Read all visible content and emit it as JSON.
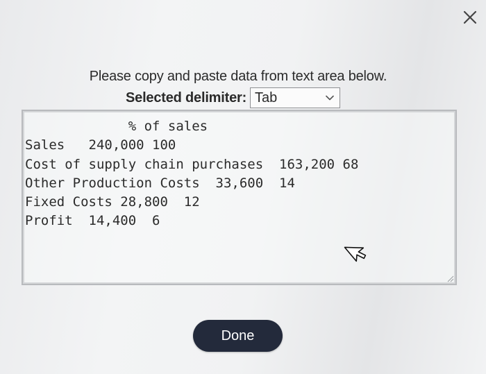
{
  "dialog": {
    "close_icon": "close-icon",
    "instructions": "Please copy and paste data from text area below.",
    "delimiter_label": "Selected delimiter:",
    "delimiter_value": "Tab",
    "text_area": {
      "lines": [
        "             % of sales",
        "Sales\t240,000 100",
        "Cost of supply chain purchases\t163,200 68",
        "Other Production Costs\t33,600\t14",
        "Fixed Costs\t28,800\t12",
        "Profit\t14,400\t6"
      ]
    },
    "done_label": "Done"
  }
}
